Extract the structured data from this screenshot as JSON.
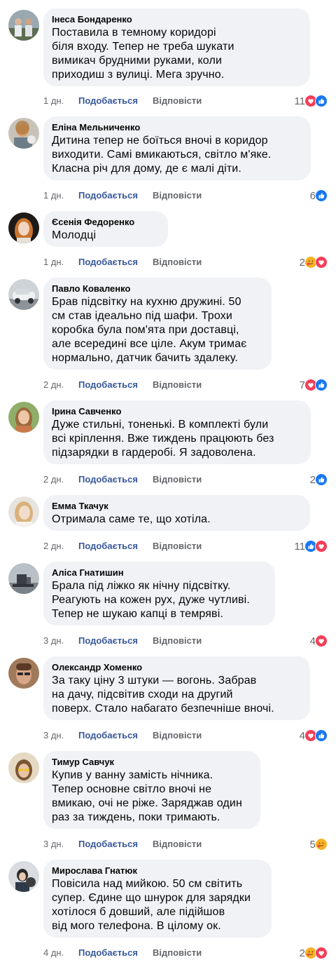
{
  "labels": {
    "like": "Подобається",
    "reply": "Відповісти"
  },
  "comments": [
    {
      "author": "Інеса Бондаренко",
      "text": "Поставила в темному коридорі\nбіля входу. Тепер не треба шукати\nвимикач брудними руками, коли\nприходиш з вулиці. Мега зручно.",
      "time": "1 дн.",
      "count": "11",
      "reactions": [
        "heart",
        "like"
      ]
    },
    {
      "author": "Еліна Мельниченко",
      "text": "Дитина тепер не боїться вночі в коридор\nвиходити. Самі вмикаються, світло м'яке.\nКласна річ для дому, де є малі діти.",
      "time": "1 дн.",
      "count": "6",
      "reactions": [
        "like"
      ]
    },
    {
      "author": "Єсенія Федоренко",
      "text": "Молодці",
      "time": "1 дн.",
      "count": "2",
      "reactions": [
        "care",
        "heart"
      ]
    },
    {
      "author": "Павло Коваленко",
      "text": "Брав підсвітку на кухню дружині. 50\nсм став ідеально під шафи. Трохи\nкоробка була пом'ята при доставці,\nале всередині все ціле. Акум тримає\nнормально, датчик бачить здалеку.",
      "time": "2 дн.",
      "count": "7",
      "reactions": [
        "heart",
        "like"
      ]
    },
    {
      "author": "Ірина Савченко",
      "text": "Дуже стильні, тоненькі. В комплекті були\nвсі кріплення. Вже тиждень працюють без\nпідзарядки в гардеробі. Я задоволена.",
      "time": "2 дн.",
      "count": "2",
      "reactions": [
        "like"
      ]
    },
    {
      "author": "Емма Ткачук",
      "text": "Отримала саме те, що хотіла.",
      "time": "2 дн.",
      "count": "11",
      "reactions": [
        "like",
        "heart"
      ]
    },
    {
      "author": "Аліса Гнатишин",
      "text": "Брала під ліжко як нічну підсвітку.\nРеагують на кожен рух, дуже чутливі.\nТепер не шукаю капці в темряві.",
      "time": "3 дн.",
      "count": "4",
      "reactions": [
        "heart"
      ]
    },
    {
      "author": "Олександр Хоменко",
      "text": "За таку ціну 3 штуки — вогонь. Забрав\nна дачу, підсвітив сходи на другий\nповерх. Стало набагато безпечніше вночі.",
      "time": "3 дн.",
      "count": "4",
      "reactions": [
        "heart",
        "like"
      ]
    },
    {
      "author": "Тимур Савчук",
      "text": "Купив у ванну замість нічника.\nТепер основне світло вночі не\nвмикаю, очі не ріже. Заряджав один\nраз за тиждень, поки тримають.",
      "time": "3 дн.",
      "count": "5",
      "reactions": [
        "care"
      ]
    },
    {
      "author": "Мирослава Гнатюк",
      "text": "Повісила над мийкою. 50 см світить\nсупер. Єдине що шнурок для зарядки\nхотілося б довший, але підійшов\nвід мого телефона. В цілому ок.",
      "time": "4 дн.",
      "count": "2",
      "reactions": [
        "care",
        "heart"
      ]
    }
  ],
  "colors": {
    "like_blue": "#1877f2",
    "heart_red": "#f33e58",
    "care_yellow": "#f7b125",
    "bubble": "#f0f2f5",
    "meta_grey": "#65676b",
    "like_label": "#385898"
  }
}
